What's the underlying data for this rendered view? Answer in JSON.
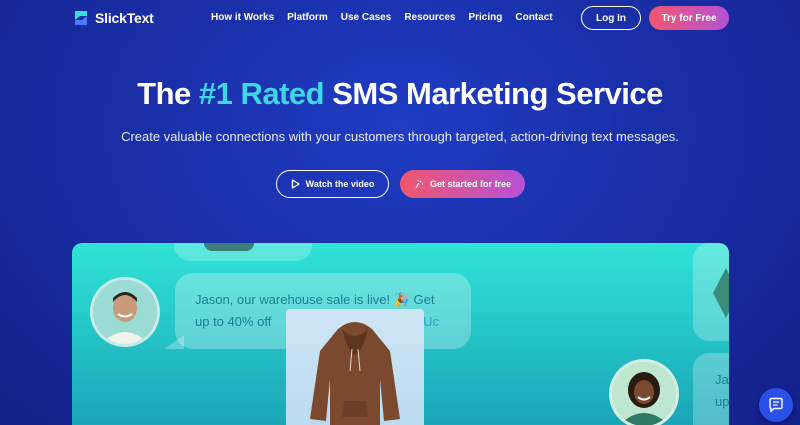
{
  "brand": {
    "name": "SlickText"
  },
  "nav": {
    "links": [
      "How it Works",
      "Platform",
      "Use Cases",
      "Resources",
      "Pricing",
      "Contact"
    ],
    "login_label": "Log In",
    "try_label": "Try for Free"
  },
  "hero": {
    "title_pre": "The ",
    "title_accent": "#1 Rated",
    "title_post": " SMS Marketing Service",
    "subtitle": "Create valuable connections with your customers through targeted, action-driving text messages.",
    "watch_label": "Watch the video",
    "start_label": "Get started for free"
  },
  "showcase": {
    "message_line1": "Jason, our warehouse sale is live! 🎉 Get",
    "message_line2_start": "up to 40% off",
    "message_line2_end": "Uc",
    "right_bubble_line1": "Ja",
    "right_bubble_line2": "up"
  },
  "colors": {
    "accent": "#3fd6e6",
    "cta_gradient_start": "#f0566e",
    "cta_gradient_end": "#b552d6",
    "background": "#1a2fa8",
    "showcase": "#30e4d6"
  },
  "icons": [
    "logo-icon",
    "play-icon",
    "sparkle-icon",
    "chat-icon"
  ]
}
